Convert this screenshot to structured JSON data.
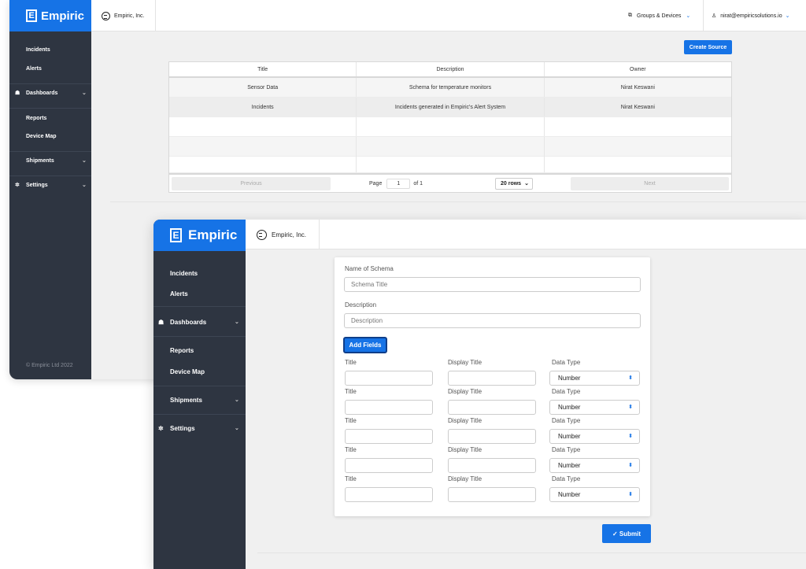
{
  "back_window": {
    "brand": {
      "logo_letter": "E",
      "name": "Empiric"
    },
    "company": "Empiric, Inc.",
    "sidebar": {
      "items": [
        {
          "label": "Incidents"
        },
        {
          "label": "Alerts"
        },
        {
          "label": "Dashboards",
          "icon": "dashboard-icon",
          "chevron": "⌄"
        },
        {
          "label": "Reports"
        },
        {
          "label": "Device Map"
        },
        {
          "label": "Shipments",
          "chevron": "⌄"
        },
        {
          "label": "Settings",
          "icon": "gear-icon",
          "chevron": "⌄"
        }
      ],
      "footer": "© Empiric Ltd 2022"
    },
    "topbar": {
      "groups_label": "Groups & Devices",
      "user_email": "nirat@empiricsolutions.io"
    },
    "create_button": "Create Source",
    "table": {
      "columns": [
        "Title",
        "Description",
        "Owner"
      ],
      "rows": [
        [
          "Sensor Data",
          "Schema for temperature monitors",
          "Nirat Keswani"
        ],
        [
          "Incidents",
          "Incidents generated in Empiric's Alert System",
          "Nirat Keswani"
        ],
        [
          "",
          "",
          ""
        ],
        [
          "",
          "",
          ""
        ],
        [
          "",
          "",
          ""
        ]
      ],
      "pager": {
        "previous": "Previous",
        "page_label": "Page",
        "page_value": "1",
        "of_label": "of 1",
        "rows_select": "20 rows",
        "next": "Next"
      }
    }
  },
  "front_window": {
    "brand": {
      "logo_letter": "E",
      "name": "Empiric"
    },
    "company": "Empiric, Inc.",
    "sidebar": {
      "items": [
        {
          "label": "Incidents"
        },
        {
          "label": "Alerts"
        },
        {
          "label": "Dashboards",
          "icon": "dashboard-icon",
          "chevron": "⌄"
        },
        {
          "label": "Reports"
        },
        {
          "label": "Device Map"
        },
        {
          "label": "Shipments",
          "chevron": "⌄"
        },
        {
          "label": "Settings",
          "icon": "gear-icon",
          "chevron": "⌄"
        }
      ]
    },
    "form": {
      "name_label": "Name of Schema",
      "name_placeholder": "Schema Title",
      "description_label": "Description",
      "description_placeholder": "Description",
      "add_fields_button": "Add Fields",
      "field_rows": [
        {
          "title_label": "Title",
          "display_label": "Display Title",
          "type_label": "Data Type",
          "type_value": "Number"
        },
        {
          "title_label": "Title",
          "display_label": "Display Title",
          "type_label": "Data Type",
          "type_value": "Number"
        },
        {
          "title_label": "Title",
          "display_label": "Display Title",
          "type_label": "Data Type",
          "type_value": "Number"
        },
        {
          "title_label": "Title",
          "display_label": "Display Title",
          "type_label": "Data Type",
          "type_value": "Number"
        },
        {
          "title_label": "Title",
          "display_label": "Display Title",
          "type_label": "Data Type",
          "type_value": "Number"
        }
      ],
      "submit_button": "Submit"
    }
  },
  "colors": {
    "accent": "#1673e6",
    "sidebar": "#2e3541",
    "background": "#f0f0f0"
  }
}
